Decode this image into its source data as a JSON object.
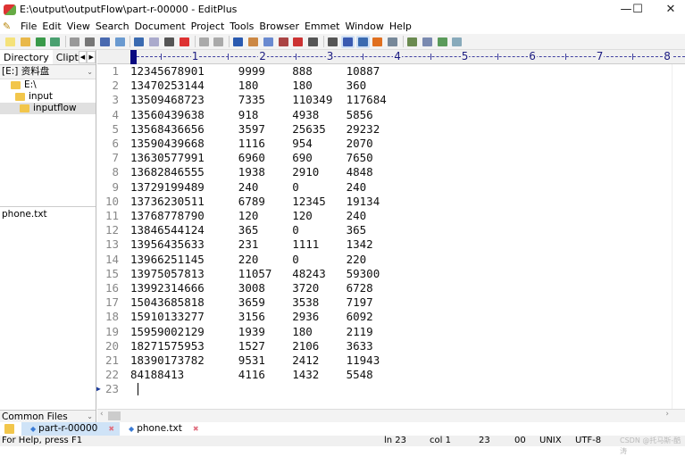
{
  "window": {
    "title": "E:\\output\\outputFlow\\part-r-00000 - EditPlus",
    "minimize": "—",
    "maximize": "☐",
    "close": "✕"
  },
  "menu": [
    "File",
    "Edit",
    "View",
    "Search",
    "Document",
    "Project",
    "Tools",
    "Browser",
    "Emmet",
    "Window",
    "Help"
  ],
  "toolbar_icons": [
    "new-file",
    "open",
    "save",
    "save-all",
    "cut-print-preview",
    "print",
    "spell-check",
    "browser-preview",
    "cut",
    "copy",
    "paste",
    "delete",
    "undo",
    "redo",
    "find",
    "replace",
    "find-in-files",
    "goto",
    "font",
    "hex",
    "word-wrap",
    "indent",
    "line-number",
    "check",
    "window1",
    "window2",
    "window3",
    "window4",
    "help"
  ],
  "sidebar": {
    "tabs": [
      "Directory",
      "Clipte"
    ],
    "drive": "[E:] 资料盘",
    "tree": [
      {
        "label": "E:\\",
        "level": 0
      },
      {
        "label": "input",
        "level": 1
      },
      {
        "label": "inputflow",
        "level": 2,
        "selected": true
      }
    ],
    "files": [
      "phone.txt"
    ],
    "filter": "Common Files (*.txt)"
  },
  "ruler": {
    "labels": [
      "1",
      "2",
      "3",
      "4",
      "5",
      "6",
      "7",
      "8"
    ]
  },
  "editor": {
    "lines": [
      [
        "12345678901",
        "9999",
        "888",
        "10887"
      ],
      [
        "13470253144",
        "180",
        "180",
        "360"
      ],
      [
        "13509468723",
        "7335",
        "110349",
        "117684"
      ],
      [
        "13560439638",
        "918",
        "4938",
        "5856"
      ],
      [
        "13568436656",
        "3597",
        "25635",
        "29232"
      ],
      [
        "13590439668",
        "1116",
        "954",
        "2070"
      ],
      [
        "13630577991",
        "6960",
        "690",
        "7650"
      ],
      [
        "13682846555",
        "1938",
        "2910",
        "4848"
      ],
      [
        "13729199489",
        "240",
        "0",
        "240"
      ],
      [
        "13736230511",
        "6789",
        "12345",
        "19134"
      ],
      [
        "13768778790",
        "120",
        "120",
        "240"
      ],
      [
        "13846544124",
        "365",
        "0",
        "365"
      ],
      [
        "13956435633",
        "231",
        "1111",
        "1342"
      ],
      [
        "13966251145",
        "220",
        "0",
        "220"
      ],
      [
        "13975057813",
        "11057",
        "48243",
        "59300"
      ],
      [
        "13992314666",
        "3008",
        "3720",
        "6728"
      ],
      [
        "15043685818",
        "3659",
        "3538",
        "7197"
      ],
      [
        "15910133277",
        "3156",
        "2936",
        "6092"
      ],
      [
        "15959002129",
        "1939",
        "180",
        "2119"
      ],
      [
        "18271575953",
        "1527",
        "2106",
        "3633"
      ],
      [
        "18390173782",
        "9531",
        "2412",
        "11943"
      ],
      [
        "84188413",
        "4116",
        "1432",
        "5548"
      ],
      []
    ]
  },
  "file_tabs": [
    {
      "label": "part-r-00000",
      "active": true
    },
    {
      "label": "phone.txt",
      "active": false
    }
  ],
  "status": {
    "help": "For Help, press F1",
    "line": "ln 23",
    "col": "col 1",
    "num": "23",
    "code": "00",
    "eol": "UNIX",
    "encoding": "UTF-8",
    "watermark": "CSDN @托马斯-酷涛"
  }
}
